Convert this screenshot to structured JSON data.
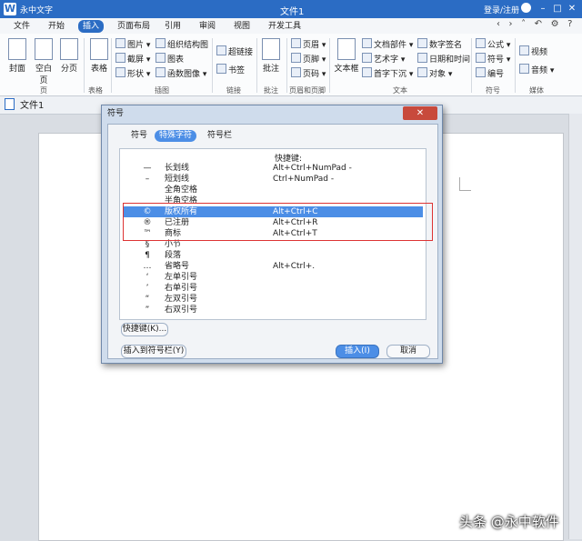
{
  "app": {
    "name": "永中文字",
    "doc_title": "文件1",
    "login": "登录/注册"
  },
  "menu": {
    "tabs": [
      "文件",
      "开始",
      "插入",
      "页面布局",
      "引用",
      "审阅",
      "视图",
      "开发工具"
    ],
    "active": "插入"
  },
  "ribbon": {
    "big": [
      "封面",
      "空白页",
      "分页",
      "表格",
      "批注",
      "文本框"
    ],
    "small": {
      "insert_col": [
        "图片",
        "截屏",
        "形状"
      ],
      "chart_col": [
        "组织结构图",
        "图表",
        "函数图像"
      ],
      "link_col": [
        "超链接",
        "书签"
      ],
      "header_col": [
        "页眉",
        "页脚",
        "页码"
      ],
      "text_col1": [
        "文档部件",
        "艺术字",
        "首字下沉"
      ],
      "text_col2": [
        "数字签名",
        "日期和时间",
        "对象"
      ],
      "symbol_col": [
        "公式",
        "符号",
        "编号"
      ],
      "media_col": [
        "视频",
        "音频"
      ]
    },
    "groups": [
      "页",
      "表格",
      "插图",
      "链接",
      "批注",
      "页眉和页脚",
      "文本",
      "符号",
      "媒体"
    ]
  },
  "doc_tab": "文件1",
  "dialog": {
    "title": "符号",
    "tabs": [
      "符号",
      "特殊字符",
      "符号栏"
    ],
    "active_tab": "特殊字符",
    "shortcut_header": "快捷键:",
    "rows": [
      {
        "sym": "—",
        "name": "长划线",
        "shortcut": "Alt+Ctrl+NumPad -"
      },
      {
        "sym": "–",
        "name": "短划线",
        "shortcut": "Ctrl+NumPad -"
      },
      {
        "sym": "",
        "name": "全角空格",
        "shortcut": ""
      },
      {
        "sym": "",
        "name": "半角空格",
        "shortcut": ""
      },
      {
        "sym": "©",
        "name": "版权所有",
        "shortcut": "Alt+Ctrl+C",
        "selected": true
      },
      {
        "sym": "®",
        "name": "已注册",
        "shortcut": "Alt+Ctrl+R"
      },
      {
        "sym": "™",
        "name": "商标",
        "shortcut": "Alt+Ctrl+T"
      },
      {
        "sym": "§",
        "name": "小节",
        "shortcut": ""
      },
      {
        "sym": "¶",
        "name": "段落",
        "shortcut": ""
      },
      {
        "sym": "…",
        "name": "省略号",
        "shortcut": "Alt+Ctrl+."
      },
      {
        "sym": "‘",
        "name": "左单引号",
        "shortcut": ""
      },
      {
        "sym": "’",
        "name": "右单引号",
        "shortcut": ""
      },
      {
        "sym": "“",
        "name": "左双引号",
        "shortcut": ""
      },
      {
        "sym": "”",
        "name": "右双引号",
        "shortcut": ""
      }
    ],
    "shortcut_button": "快捷键(K)...",
    "insert_to_bar": "插入到符号栏(Y)",
    "insert_button": "插入(I)",
    "cancel_button": "取消"
  },
  "watermark": "头条 @永中软件",
  "colors": {
    "accent": "#2b6cc4",
    "selection": "#4c8ee6",
    "highlight_box": "#dd3333"
  }
}
